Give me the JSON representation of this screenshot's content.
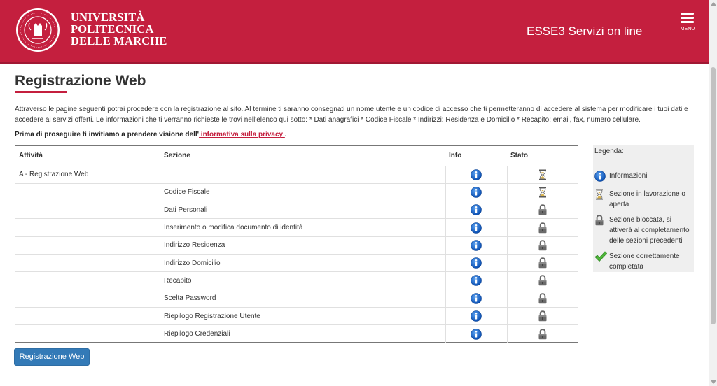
{
  "header": {
    "logo_lines": [
      "UNIVERSITÀ",
      "POLITECNICA",
      "DELLE MARCHE"
    ],
    "seal_text": "UNIVERSITÀ POLITECNICA DELLE MARCHE",
    "service_title": "ESSE3 Servizi on line",
    "menu_label": "MENU",
    "accent_color": "#c41f3e"
  },
  "page": {
    "title": "Registrazione Web",
    "intro": "Attraverso le pagine seguenti potrai procedere con la registrazione al sito. Al termine ti saranno consegnati un nome utente e un codice di accesso che ti permetteranno di accedere al sistema per modificare i tuoi dati e accedere ai servizi offerti. Le informazioni che ti verranno richieste le trovi nell'elenco qui sotto: * Dati anagrafici * Codice Fiscale * Indirizzi: Residenza e Domicilio * Recapito: email, fax, numero cellulare.",
    "privacy_prefix": "Prima di proseguire ti invitiamo a prendere visione dell'",
    "privacy_link": " informativa sulla privacy ",
    "privacy_suffix": "."
  },
  "table": {
    "headers": [
      "Attività",
      "Sezione",
      "Info",
      "Stato"
    ],
    "rows": [
      {
        "attivita": "A - Registrazione Web",
        "sezione": "",
        "info": "info-icon",
        "stato": "hourglass"
      },
      {
        "attivita": "",
        "sezione": "Codice Fiscale",
        "info": "info-icon",
        "stato": "hourglass"
      },
      {
        "attivita": "",
        "sezione": "Dati Personali",
        "info": "info-icon",
        "stato": "lock"
      },
      {
        "attivita": "",
        "sezione": "Inserimento o modifica documento di identità",
        "info": "info-icon",
        "stato": "lock"
      },
      {
        "attivita": "",
        "sezione": "Indirizzo Residenza",
        "info": "info-icon",
        "stato": "lock"
      },
      {
        "attivita": "",
        "sezione": "Indirizzo Domicilio",
        "info": "info-icon",
        "stato": "lock"
      },
      {
        "attivita": "",
        "sezione": "Recapito",
        "info": "info-icon",
        "stato": "lock"
      },
      {
        "attivita": "",
        "sezione": "Scelta Password",
        "info": "info-icon",
        "stato": "lock"
      },
      {
        "attivita": "",
        "sezione": "Riepilogo Registrazione Utente",
        "info": "info-icon",
        "stato": "lock"
      },
      {
        "attivita": "",
        "sezione": "Riepilogo Credenziali",
        "info": "info-icon",
        "stato": "lock"
      }
    ]
  },
  "legend": {
    "title": "Legenda:",
    "items": [
      {
        "icon": "info-icon",
        "text": "Informazioni"
      },
      {
        "icon": "hourglass",
        "text": "Sezione in lavorazione o aperta"
      },
      {
        "icon": "lock",
        "text": "Sezione bloccata, si attiverà al completamento delle sezioni precedenti"
      },
      {
        "icon": "checkmark",
        "text": "Sezione correttamente completata"
      }
    ]
  },
  "actions": {
    "submit_label": "Registrazione Web"
  }
}
